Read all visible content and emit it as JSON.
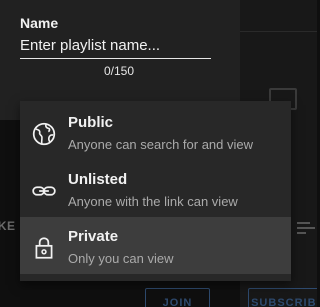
{
  "background": {
    "edge_text": "IKE",
    "join_label": "JOIN",
    "subscribe_label": "SUBSCRIBE"
  },
  "dialog": {
    "name_label": "Name",
    "name_value": "Enter playlist name...",
    "char_counter": "0/150"
  },
  "privacy_menu": {
    "items": [
      {
        "title": "Public",
        "description": "Anyone can search for and view",
        "icon": "globe-icon",
        "selected": false
      },
      {
        "title": "Unlisted",
        "description": "Anyone with the link can view",
        "icon": "link-icon",
        "selected": false
      },
      {
        "title": "Private",
        "description": "Only you can view",
        "icon": "lock-icon",
        "selected": true
      }
    ]
  },
  "colors": {
    "dialog_bg": "#212121",
    "menu_bg": "#282828",
    "menu_selected_bg": "#3d3d3d",
    "text_primary": "#f1f1f1",
    "text_secondary": "#aaaaaa",
    "button_outline": "#2e4a6e"
  }
}
